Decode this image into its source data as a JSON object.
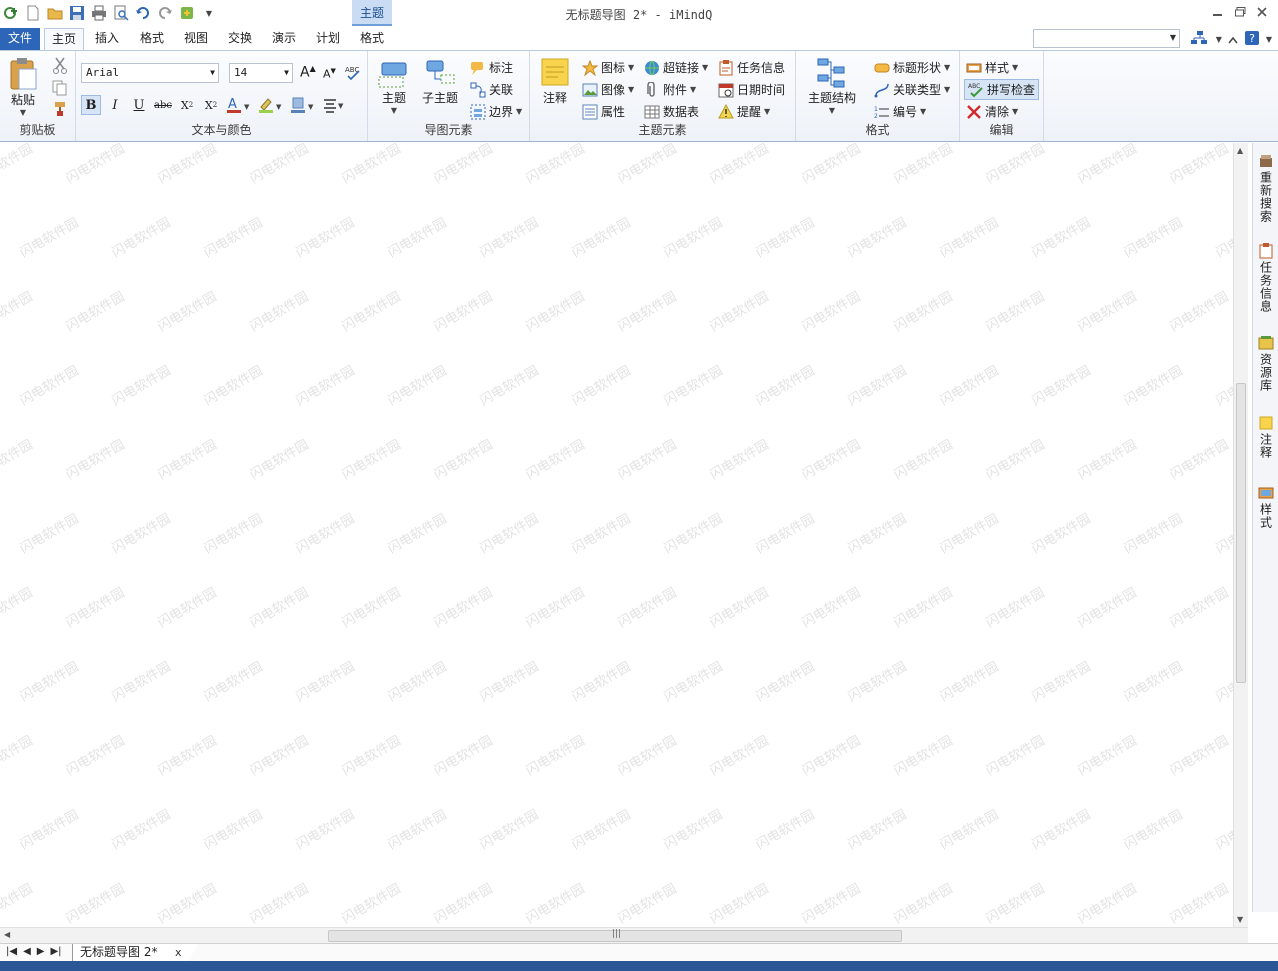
{
  "window": {
    "title": "无标题导图 2* - iMindQ",
    "context_tab": "主题"
  },
  "tabs": [
    {
      "label": "文件"
    },
    {
      "label": "主页"
    },
    {
      "label": "插入"
    },
    {
      "label": "格式"
    },
    {
      "label": "视图"
    },
    {
      "label": "交换"
    },
    {
      "label": "演示"
    },
    {
      "label": "计划"
    },
    {
      "label": "格式"
    }
  ],
  "ribbon": {
    "clipboard": {
      "label": "剪贴板",
      "paste": "粘贴"
    },
    "text": {
      "label": "文本与颜色",
      "font": "Arial",
      "size": "14"
    },
    "elements": {
      "label": "导图元素",
      "topic": "主题",
      "subtopic": "子主题",
      "callout": "标注",
      "relationship": "关联",
      "boundary": "边界"
    },
    "topic_elements": {
      "label": "主题元素",
      "note": "注释",
      "icon": "图标",
      "image": "图像",
      "properties": "属性",
      "hyperlink": "超链接",
      "attachment": "附件",
      "datatable": "数据表",
      "taskinfo": "任务信息",
      "datetime": "日期时间",
      "reminder": "提醒"
    },
    "format": {
      "label": "格式",
      "structure": "主题结构",
      "shape": "标题形状",
      "reltype": "关联类型",
      "numbering": "编号"
    },
    "edit": {
      "label": "编辑",
      "style": "样式",
      "spellcheck": "拼写检查",
      "clear": "清除"
    }
  },
  "sidepanel": [
    {
      "label": "重新搜索"
    },
    {
      "label": "任务信息"
    },
    {
      "label": "资源库"
    },
    {
      "label": "注释"
    },
    {
      "label": "样式"
    }
  ],
  "sheets": [
    {
      "label": "无标题导图 2*"
    }
  ],
  "watermark": "闪电软件园",
  "colors": {
    "accent": "#2d66b8",
    "statusbar": "#2b5797"
  }
}
